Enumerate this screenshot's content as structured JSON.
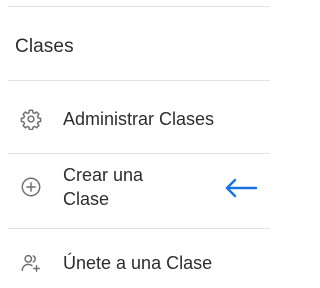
{
  "menu": {
    "section_title": "Clases",
    "items": [
      {
        "label": "Administrar Clases",
        "icon": "gear-icon"
      },
      {
        "label": "Crear una Clase",
        "icon": "plus-circle-icon"
      },
      {
        "label": "Únete a una Clase",
        "icon": "people-add-icon"
      }
    ]
  },
  "annotation": {
    "icon": "arrow-left-icon",
    "color": "#1a73e8"
  },
  "colors": {
    "text": "#2b2d31",
    "icon": "#6b7177",
    "divider": "#dde3e8"
  }
}
